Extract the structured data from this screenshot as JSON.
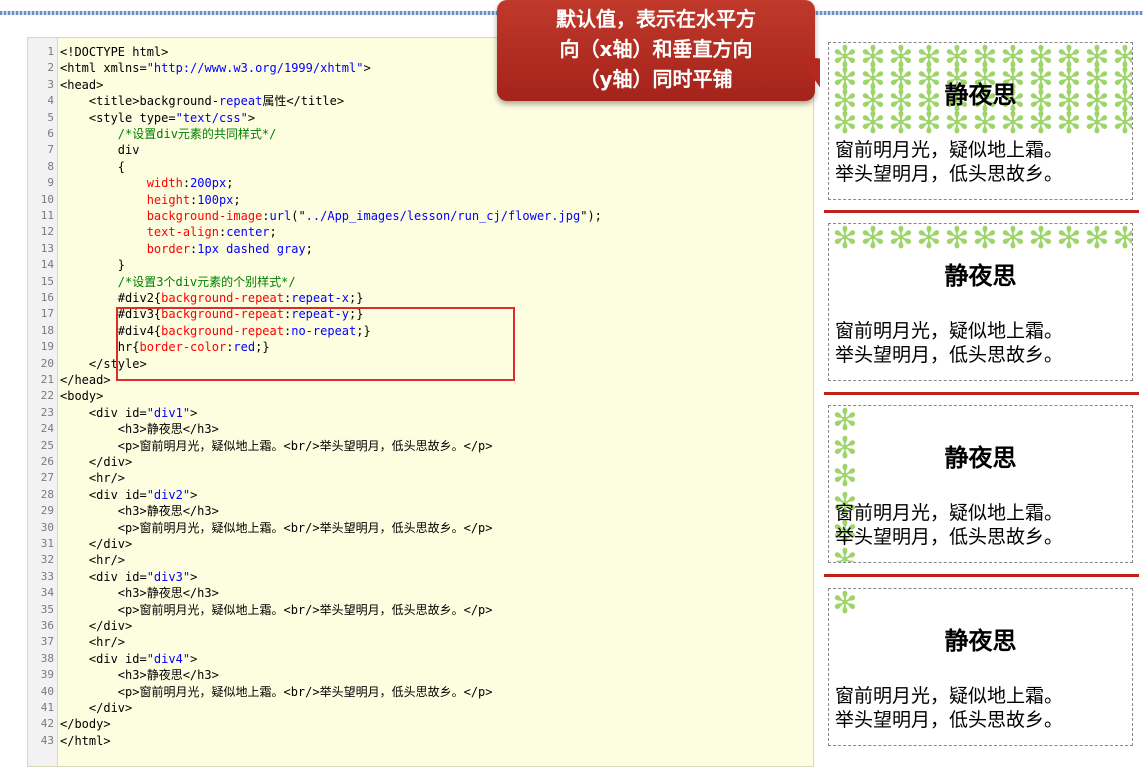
{
  "callout": {
    "line1": "默认值，表示在水平方",
    "line2": "向（x轴）和垂直方向",
    "line3": "（y轴）同时平铺"
  },
  "code": {
    "lines": [
      {
        "n": "1",
        "parts": [
          [
            "kw",
            "<!DOCTYPE html>"
          ]
        ]
      },
      {
        "n": "2",
        "parts": [
          [
            "kw",
            "<html xmlns="
          ],
          [
            "str",
            "\"http://www.w3.org/1999/xhtml\""
          ],
          [
            "kw",
            ">"
          ]
        ]
      },
      {
        "n": "3",
        "parts": [
          [
            "kw",
            "<head>"
          ]
        ]
      },
      {
        "n": "4",
        "parts": [
          [
            "kw",
            "    <title>background-"
          ],
          [
            "str",
            "repeat"
          ],
          [
            "kw",
            "属性</title>"
          ]
        ]
      },
      {
        "n": "5",
        "parts": [
          [
            "kw",
            "    <style type="
          ],
          [
            "str",
            "\"text/css\""
          ],
          [
            "kw",
            ">"
          ]
        ]
      },
      {
        "n": "6",
        "parts": [
          [
            "cmt",
            "        /*设置div元素的共同样式*/"
          ]
        ]
      },
      {
        "n": "7",
        "parts": [
          [
            "kw",
            "        div"
          ]
        ]
      },
      {
        "n": "8",
        "parts": [
          [
            "kw",
            "        {"
          ]
        ]
      },
      {
        "n": "9",
        "parts": [
          [
            "prop",
            "            width"
          ],
          [
            "kw",
            ":"
          ],
          [
            "val",
            "200px"
          ],
          [
            "kw",
            ";"
          ]
        ]
      },
      {
        "n": "10",
        "parts": [
          [
            "prop",
            "            height"
          ],
          [
            "kw",
            ":"
          ],
          [
            "val",
            "100px"
          ],
          [
            "kw",
            ";"
          ]
        ]
      },
      {
        "n": "11",
        "parts": [
          [
            "prop",
            "            background-image"
          ],
          [
            "kw",
            ":"
          ],
          [
            "val",
            "url"
          ],
          [
            "kw",
            "(\""
          ],
          [
            "val",
            "../App_images/lesson/run_cj/flower.jpg"
          ],
          [
            "kw",
            "\");"
          ]
        ]
      },
      {
        "n": "12",
        "parts": [
          [
            "prop",
            "            text-align"
          ],
          [
            "kw",
            ":"
          ],
          [
            "val",
            "center"
          ],
          [
            "kw",
            ";"
          ]
        ]
      },
      {
        "n": "13",
        "parts": [
          [
            "prop",
            "            border"
          ],
          [
            "kw",
            ":"
          ],
          [
            "val",
            "1px dashed gray"
          ],
          [
            "kw",
            ";"
          ]
        ]
      },
      {
        "n": "14",
        "parts": [
          [
            "kw",
            "        }"
          ]
        ]
      },
      {
        "n": "15",
        "parts": [
          [
            "cmt",
            "        /*设置3个div元素的个别样式*/"
          ]
        ]
      },
      {
        "n": "16",
        "parts": [
          [
            "kw",
            "        #div2{"
          ],
          [
            "prop",
            "background-repeat"
          ],
          [
            "kw",
            ":"
          ],
          [
            "val",
            "repeat-x"
          ],
          [
            "kw",
            ";}"
          ]
        ]
      },
      {
        "n": "17",
        "parts": [
          [
            "kw",
            "        #div3{"
          ],
          [
            "prop",
            "background-repeat"
          ],
          [
            "kw",
            ":"
          ],
          [
            "val",
            "repeat-y"
          ],
          [
            "kw",
            ";}"
          ]
        ]
      },
      {
        "n": "18",
        "parts": [
          [
            "kw",
            "        #div4{"
          ],
          [
            "prop",
            "background-repeat"
          ],
          [
            "kw",
            ":"
          ],
          [
            "val",
            "no-repeat"
          ],
          [
            "kw",
            ";}"
          ]
        ]
      },
      {
        "n": "19",
        "parts": [
          [
            "kw",
            "        hr{"
          ],
          [
            "prop",
            "border-color"
          ],
          [
            "kw",
            ":"
          ],
          [
            "val",
            "red"
          ],
          [
            "kw",
            ";}"
          ]
        ]
      },
      {
        "n": "20",
        "parts": [
          [
            "kw",
            "    </style>"
          ]
        ]
      },
      {
        "n": "21",
        "parts": [
          [
            "kw",
            "</head>"
          ]
        ]
      },
      {
        "n": "22",
        "parts": [
          [
            "kw",
            "<body>"
          ]
        ]
      },
      {
        "n": "23",
        "parts": [
          [
            "kw",
            "    <div id="
          ],
          [
            "str",
            "\"div1\""
          ],
          [
            "kw",
            ">"
          ]
        ]
      },
      {
        "n": "24",
        "parts": [
          [
            "kw",
            "        <h3>静夜思</h3>"
          ]
        ]
      },
      {
        "n": "25",
        "parts": [
          [
            "kw",
            "        <p>窗前明月光，疑似地上霜。<br/>举头望明月，低头思故乡。</p>"
          ]
        ]
      },
      {
        "n": "26",
        "parts": [
          [
            "kw",
            "    </div>"
          ]
        ]
      },
      {
        "n": "27",
        "parts": [
          [
            "kw",
            "    <hr/>"
          ]
        ]
      },
      {
        "n": "28",
        "parts": [
          [
            "kw",
            "    <div id="
          ],
          [
            "str",
            "\"div2\""
          ],
          [
            "kw",
            ">"
          ]
        ]
      },
      {
        "n": "29",
        "parts": [
          [
            "kw",
            "        <h3>静夜思</h3>"
          ]
        ]
      },
      {
        "n": "30",
        "parts": [
          [
            "kw",
            "        <p>窗前明月光，疑似地上霜。<br/>举头望明月，低头思故乡。</p>"
          ]
        ]
      },
      {
        "n": "31",
        "parts": [
          [
            "kw",
            "    </div>"
          ]
        ]
      },
      {
        "n": "32",
        "parts": [
          [
            "kw",
            "    <hr/>"
          ]
        ]
      },
      {
        "n": "33",
        "parts": [
          [
            "kw",
            "    <div id="
          ],
          [
            "str",
            "\"div3\""
          ],
          [
            "kw",
            ">"
          ]
        ]
      },
      {
        "n": "34",
        "parts": [
          [
            "kw",
            "        <h3>静夜思</h3>"
          ]
        ]
      },
      {
        "n": "35",
        "parts": [
          [
            "kw",
            "        <p>窗前明月光，疑似地上霜。<br/>举头望明月，低头思故乡。</p>"
          ]
        ]
      },
      {
        "n": "36",
        "parts": [
          [
            "kw",
            "    </div>"
          ]
        ]
      },
      {
        "n": "37",
        "parts": [
          [
            "kw",
            "    <hr/>"
          ]
        ]
      },
      {
        "n": "38",
        "parts": [
          [
            "kw",
            "    <div id="
          ],
          [
            "str",
            "\"div4\""
          ],
          [
            "kw",
            ">"
          ]
        ]
      },
      {
        "n": "39",
        "parts": [
          [
            "kw",
            "        <h3>静夜思</h3>"
          ]
        ]
      },
      {
        "n": "40",
        "parts": [
          [
            "kw",
            "        <p>窗前明月光，疑似地上霜。<br/>举头望明月，低头思故乡。</p>"
          ]
        ]
      },
      {
        "n": "41",
        "parts": [
          [
            "kw",
            "    </div>"
          ]
        ]
      },
      {
        "n": "42",
        "parts": [
          [
            "kw",
            "</body>"
          ]
        ]
      },
      {
        "n": "43",
        "parts": [
          [
            "kw",
            "</html>"
          ]
        ]
      }
    ]
  },
  "preview": {
    "demos": [
      {
        "id": "div1",
        "repeat": "repeat",
        "title": "静夜思",
        "line1": "窗前明月光，疑似地上霜。",
        "line2": "举头望明月，低头思故乡。"
      },
      {
        "id": "div2",
        "repeat": "repeat-x",
        "title": "静夜思",
        "line1": "窗前明月光，疑似地上霜。",
        "line2": "举头望明月，低头思故乡。"
      },
      {
        "id": "div3",
        "repeat": "repeat-y",
        "title": "静夜思",
        "line1": "窗前明月光，疑似地上霜。",
        "line2": "举头望明月，低头思故乡。"
      },
      {
        "id": "div4",
        "repeat": "no-repeat",
        "title": "静夜思",
        "line1": "窗前明月光，疑似地上霜。",
        "line2": "举头望明月，低头思故乡。"
      }
    ]
  },
  "colors": {
    "callout_bg": "#b3281f",
    "highlight": "#e02b2b",
    "hr": "#c0221a",
    "flower": "#9ed56a",
    "editor_bg": "#fdfde0"
  },
  "icons": {
    "flower": "flower-icon"
  }
}
